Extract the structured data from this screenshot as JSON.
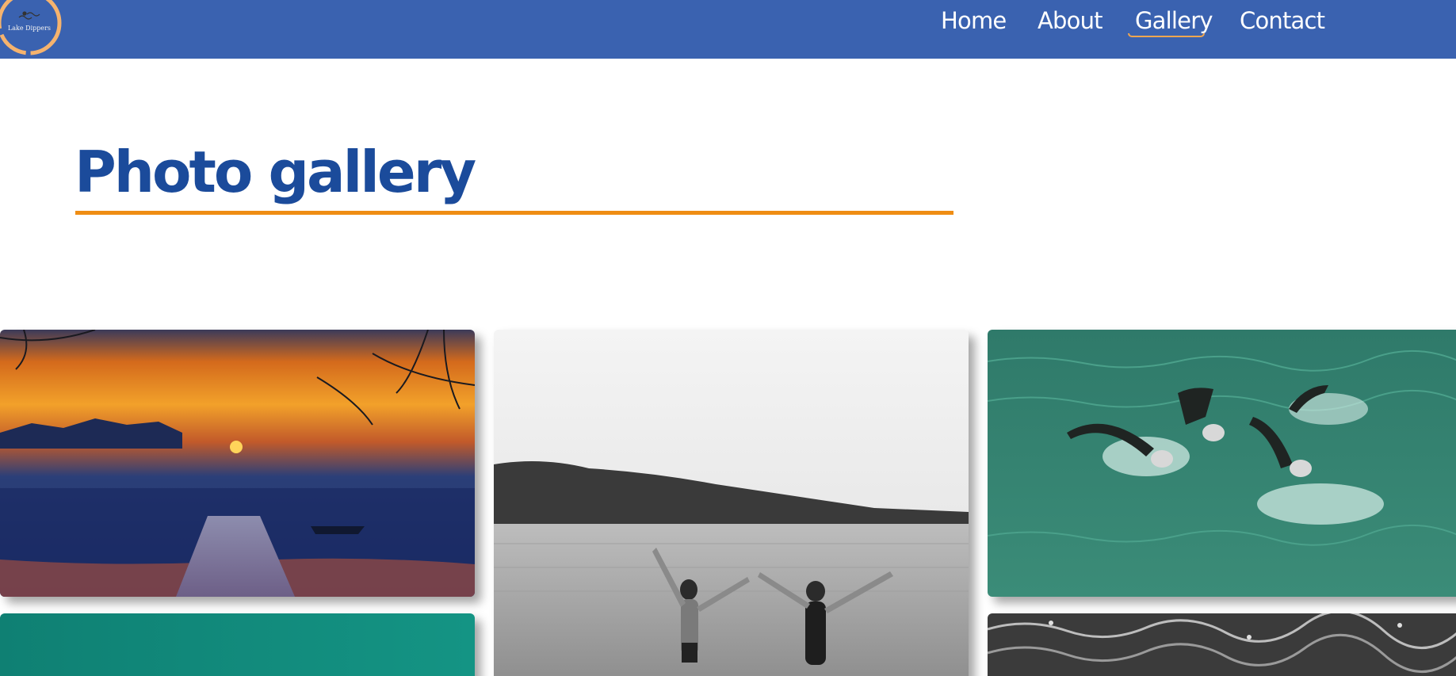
{
  "header": {
    "brand": {
      "logo_text": "Lake Dippers",
      "logo_icon": "swimmer-icon"
    },
    "nav": [
      {
        "label": "Home",
        "active": false
      },
      {
        "label": "About",
        "active": false
      },
      {
        "label": "Gallery",
        "active": true
      },
      {
        "label": "Contact",
        "active": false
      }
    ]
  },
  "main": {
    "title": "Photo gallery",
    "photos": [
      {
        "subject": "sunset over lake with wooden jetty and rowboat"
      },
      {
        "subject": "two swimmers holding hands, arms raised, entering a lake (black and white)"
      },
      {
        "subject": "group of open-water swimmers in wetsuits in green water"
      },
      {
        "subject": "teal water"
      },
      {
        "subject": "dark rippled water surface"
      }
    ]
  },
  "colors": {
    "header_bg": "#3a62b0",
    "title": "#1b4b9b",
    "accent": "#ef8d14",
    "nav_text": "#ffffff"
  }
}
